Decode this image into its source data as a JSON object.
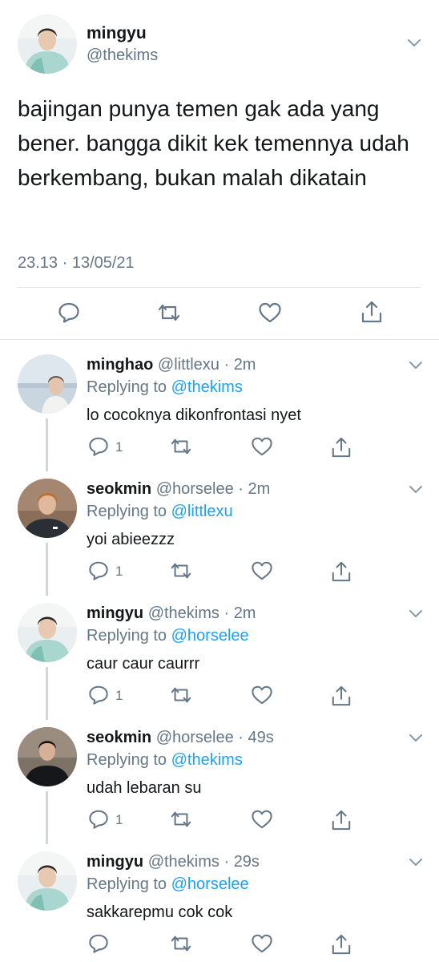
{
  "main_tweet": {
    "name": "mingyu",
    "handle": "@thekims",
    "text": "bajingan punya temen gak ada yang bener. bangga dikit kek temennya udah berkembang, bukan malah dikatain",
    "timestamp": "23.13 · 13/05/21",
    "actions": [
      "reply-icon",
      "retweet-icon",
      "like-icon",
      "share-icon"
    ]
  },
  "replies": [
    {
      "name": "minghao",
      "handle": "@littlexu",
      "time": "2m",
      "replying_label": "Replying to",
      "replying_to": "@thekims",
      "text": "lo cocoknya dikonfrontasi nyet",
      "reply_count": "1"
    },
    {
      "name": "seokmin",
      "handle": "@horselee",
      "time": "2m",
      "replying_label": "Replying to",
      "replying_to": "@littlexu",
      "text": "yoi abieezzz",
      "reply_count": "1"
    },
    {
      "name": "mingyu",
      "handle": "@thekims",
      "time": "2m",
      "replying_label": "Replying to",
      "replying_to": "@horselee",
      "text": "caur caur caurrr",
      "reply_count": "1"
    },
    {
      "name": "seokmin",
      "handle": "@horselee",
      "time": "49s",
      "replying_label": "Replying to",
      "replying_to": "@thekims",
      "text": "udah lebaran su",
      "reply_count": "1"
    },
    {
      "name": "mingyu",
      "handle": "@thekims",
      "time": "29s",
      "replying_label": "Replying to",
      "replying_to": "@horselee",
      "text": "sakkarepmu cok cok",
      "reply_count": ""
    }
  ],
  "colors": {
    "text": "#14171a",
    "secondary": "#657786",
    "accent": "#1da1f2",
    "divider": "#e1e6ea"
  }
}
